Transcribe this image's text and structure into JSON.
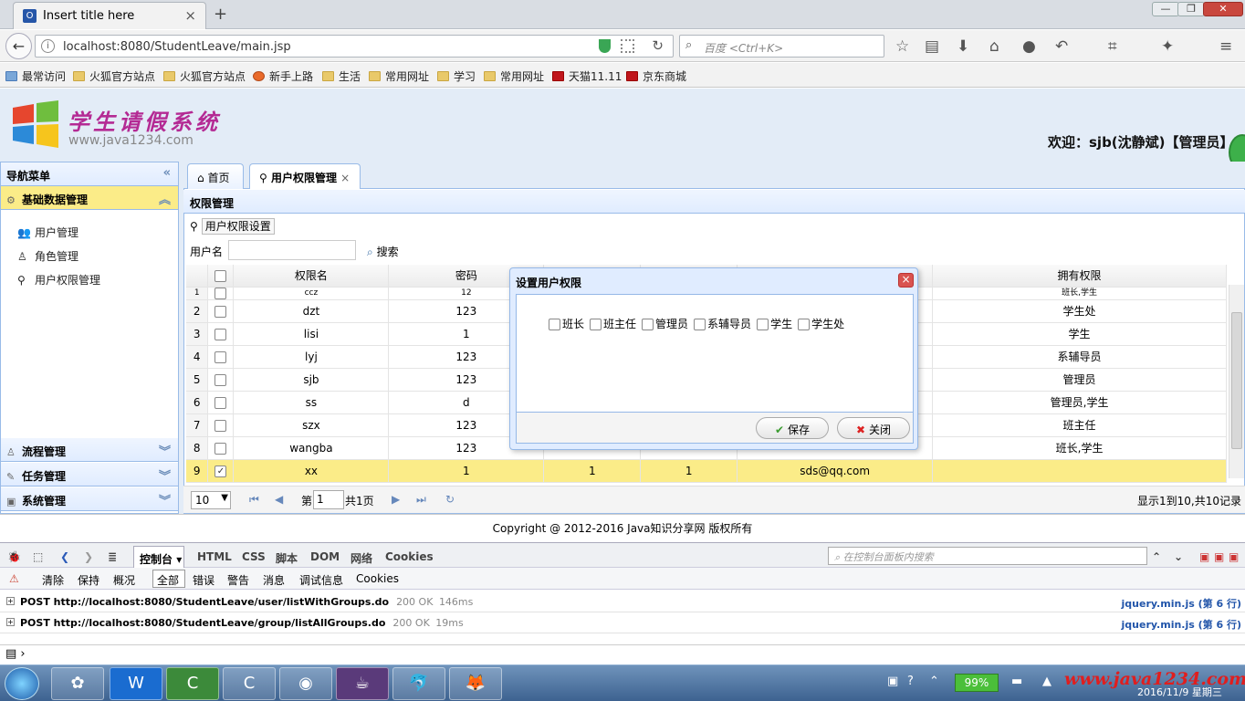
{
  "browser": {
    "tab_title": "Insert title here",
    "tab_favicon": "O",
    "url": "localhost:8080/StudentLeave/main.jsp",
    "search_placeholder": "百度 <Ctrl+K>",
    "bookmarks": [
      "最常访问",
      "火狐官方站点",
      "火狐官方站点",
      "新手上路",
      "生活",
      "常用网址",
      "学习",
      "常用网址",
      "天猫11.11",
      "京东商城"
    ]
  },
  "app": {
    "logo_title": "学生请假系统",
    "logo_sub": "www.java1234.com",
    "welcome": "欢迎：sjb(沈静斌)【管理员】",
    "sidebar": {
      "title": "导航菜单",
      "groups": [
        "基础数据管理",
        "流程管理",
        "任务管理",
        "系统管理"
      ],
      "items": [
        "用户管理",
        "角色管理",
        "用户权限管理"
      ]
    },
    "tabs": [
      "首页",
      "用户权限管理"
    ],
    "panel_title": "权限管理",
    "toolbar_button": "用户权限设置",
    "user_label": "用户名",
    "search_button": "搜索",
    "columns": [
      "权限名",
      "密码",
      "",
      "",
      "",
      "拥有权限"
    ],
    "rows": [
      {
        "n": "1",
        "name": "ccz",
        "pwd": "12",
        "c3": "",
        "c4": "",
        "email": "",
        "perm": "班长,学生"
      },
      {
        "n": "2",
        "name": "dzt",
        "pwd": "123",
        "c3": "",
        "c4": "",
        "email": "",
        "perm": "学生处"
      },
      {
        "n": "3",
        "name": "lisi",
        "pwd": "1",
        "c3": "",
        "c4": "",
        "email": "",
        "perm": "学生"
      },
      {
        "n": "4",
        "name": "lyj",
        "pwd": "123",
        "c3": "",
        "c4": "",
        "email": "",
        "perm": "系辅导员"
      },
      {
        "n": "5",
        "name": "sjb",
        "pwd": "123",
        "c3": "",
        "c4": "",
        "email": "",
        "perm": "管理员"
      },
      {
        "n": "6",
        "name": "ss",
        "pwd": "d",
        "c3": "",
        "c4": "",
        "email": "",
        "perm": "管理员,学生"
      },
      {
        "n": "7",
        "name": "szx",
        "pwd": "123",
        "c3": "",
        "c4": "",
        "email": "",
        "perm": "班主任"
      },
      {
        "n": "8",
        "name": "wangba",
        "pwd": "123",
        "c3": "",
        "c4": "",
        "email": "",
        "perm": "班长,学生"
      },
      {
        "n": "9",
        "name": "xx",
        "pwd": "1",
        "c3": "1",
        "c4": "1",
        "email": "sds@qq.com",
        "perm": ""
      }
    ],
    "pager": {
      "page_size": "10",
      "page_prefix": "第",
      "page": "1",
      "page_total": "共1页",
      "summary": "显示1到10,共10记录"
    },
    "dialog": {
      "title": "设置用户权限",
      "options": [
        "班长",
        "班主任",
        "管理员",
        "系辅导员",
        "学生",
        "学生处"
      ],
      "save": "保存",
      "close": "关闭"
    },
    "copyright": "Copyright @ 2012-2016 Java知识分享网 版权所有"
  },
  "firebug": {
    "console_tab": "控制台",
    "tabs": [
      "HTML",
      "CSS",
      "脚本",
      "DOM",
      "网络",
      "Cookies"
    ],
    "search_placeholder": "在控制台面板内搜索",
    "filters": [
      "清除",
      "保持",
      "概况",
      "全部",
      "错误",
      "警告",
      "消息",
      "调试信息",
      "Cookies"
    ],
    "logs": [
      {
        "method": "POST http://localhost:8080/StudentLeave/user/listWithGroups.do",
        "status": "200 OK",
        "time": "146ms",
        "src": "jquery.min.js (第 6 行)"
      },
      {
        "method": "POST http://localhost:8080/StudentLeave/group/listAllGroups.do",
        "status": "200 OK",
        "time": "19ms",
        "src": "jquery.min.js (第 6 行)"
      }
    ]
  },
  "taskbar": {
    "battery": "99%",
    "watermark": "www.java1234.com",
    "date": "2016/11/9 星期三"
  }
}
